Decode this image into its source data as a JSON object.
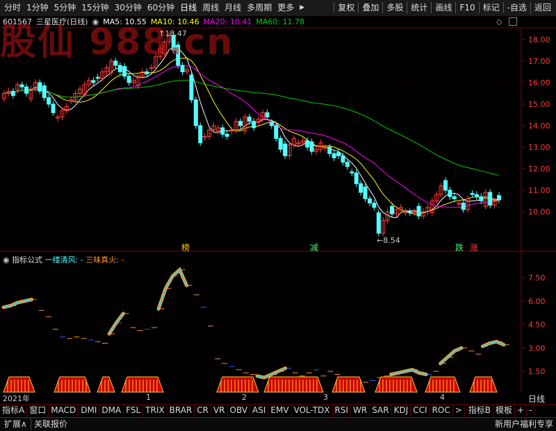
{
  "toolbar": {
    "periods": [
      "分时",
      "1分钟",
      "5分钟",
      "15分钟",
      "30分钟",
      "60分钟",
      "日线",
      "周线",
      "月线",
      "多周期",
      "更多"
    ],
    "active_period": "日线",
    "more_arrow": "▶",
    "buttons": [
      "复权",
      "叠加",
      "多股",
      "统计",
      "画线",
      "F10",
      "标记",
      "-自选",
      "返回"
    ]
  },
  "stock": {
    "code": "601567",
    "name": "三星医疗(日线)",
    "ma5_label": "MA5: 10.55",
    "ma10_label": "MA10: 10.46",
    "ma20_label": "MA20: 10.41",
    "ma60_label": "MA60: 11.78"
  },
  "watermark": "股仙 988.cn",
  "price_axis": [
    "18.00",
    "17.00",
    "16.00",
    "15.00",
    "14.00",
    "13.00",
    "12.00",
    "11.00",
    "10.00"
  ],
  "annotations": {
    "high": "18.47",
    "low": "8.54",
    "tag_bang": "榜",
    "tag_jian": "减",
    "tag_die": "跌",
    "tag_zhang": "涨"
  },
  "indicator": {
    "name": "指标公式",
    "line1": "一缕清风: -",
    "line2": "三味真火: -",
    "axis": [
      "7.50",
      "6.00",
      "4.50",
      "3.00",
      "1.50"
    ]
  },
  "date_axis": {
    "year": "2021年",
    "months": [
      "1",
      "2",
      "3",
      "4"
    ],
    "period_label": "日线"
  },
  "bottom_tabs": [
    "指标A",
    "窗口",
    "MACD",
    "DMI",
    "DMA",
    "FSL",
    "TRIX",
    "BRAR",
    "CR",
    "VR",
    "OBV",
    "ASI",
    "EMV",
    "VOL-TDX",
    "RSI",
    "WR",
    "SAR",
    "KDJ",
    "CCI",
    "ROC",
    ">",
    "指标B",
    "模板",
    "+",
    "-"
  ],
  "status": {
    "expand": "扩展∧",
    "related": "关联报价",
    "promo": "新用户福利专享"
  },
  "colors": {
    "up": "#ff3b3b",
    "down": "#54ffff",
    "ma5": "#ffffff",
    "ma10": "#ffff00",
    "ma20": "#ff00ff",
    "ma60": "#00cc00",
    "grid": "#8b0000"
  }
}
